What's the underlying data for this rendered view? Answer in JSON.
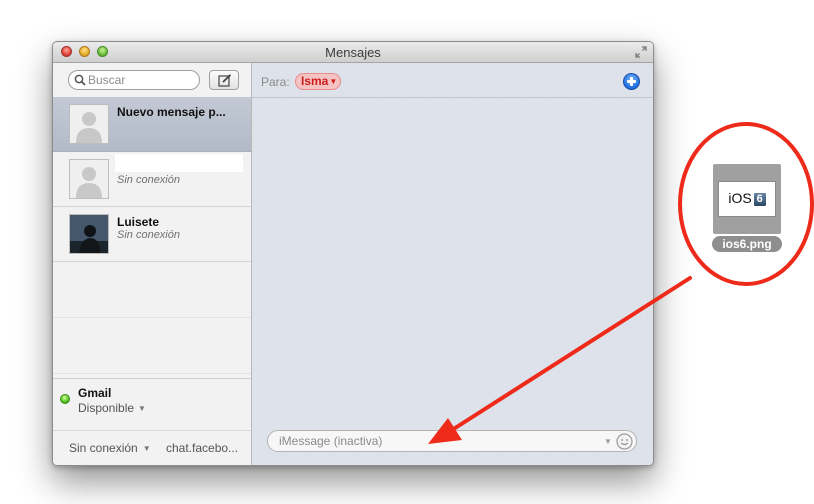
{
  "window": {
    "title": "Mensajes"
  },
  "sidebar": {
    "search_placeholder": "Buscar",
    "conversations": [
      {
        "name": "Nuevo mensaje p...",
        "status": ""
      },
      {
        "name": "",
        "status": "Sin conexión"
      },
      {
        "name": "Luisete",
        "status": "Sin conexión"
      }
    ],
    "account": {
      "name": "Gmail",
      "status": "Disponible"
    },
    "footer": {
      "status": "Sin conexión",
      "account": "chat.facebo..."
    }
  },
  "main": {
    "to_label": "Para:",
    "recipient": "Isma",
    "message_placeholder": "iMessage (inactiva)"
  },
  "desktop": {
    "file_name": "ios6.png",
    "file_thumb_text": "iOS",
    "file_thumb_number": "6"
  },
  "colors": {
    "annotation_red": "#ee2a1a",
    "recipient_red": "#cc1c1c",
    "accent_blue": "#1f6fe0",
    "status_green": "#4cc21e"
  }
}
